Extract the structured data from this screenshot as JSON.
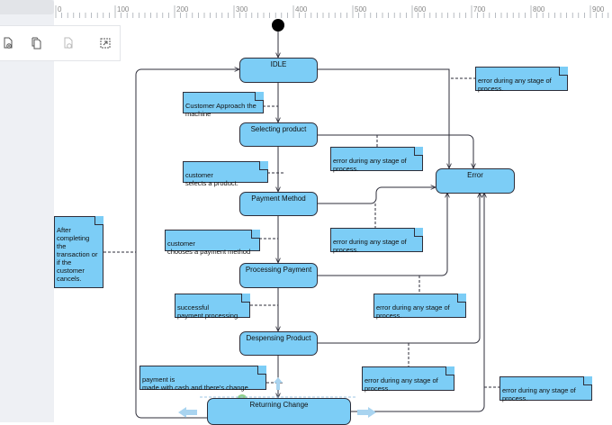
{
  "ruler": {
    "ticks": [
      "0",
      "100",
      "200",
      "300",
      "400",
      "500",
      "600",
      "700",
      "800",
      "900"
    ]
  },
  "toolbar": {
    "icons": [
      "add-page-icon",
      "duplicate-page-icon",
      "add-link-page-icon",
      "resize-page-icon"
    ]
  },
  "diagram": {
    "states": {
      "idle": "IDLE",
      "selecting_product": "Selecting product",
      "payment_method": "Payment Method",
      "processing_payment": "Processing  Payment",
      "despensing_product": "Despensing Product",
      "returning_change": "Returning Change",
      "error": "Error"
    },
    "notes": {
      "customer_approach": "Customer Approach  the\nmachine",
      "customer_selects": "customer\nselects a product.",
      "customer_chooses": "customer\nchooses a payment method",
      "successful_payment": "successful\npayment processing.",
      "payment_cash": "payment is\nmade with cash and there's change.",
      "after_completing": "After\ncompleting\nthe\ntransaction or\nif the\ncustomer\ncancels.",
      "error_1": "error during any stage of\nprocess.",
      "error_2": "error during any stage of\nprocess.",
      "error_3": "error during any stage of\nprocess.",
      "error_4": "error during any stage of\nprocess.",
      "error_5": "error during any stage of\nprocess.",
      "error_6": "error during any stage of\nprocess."
    }
  },
  "colors": {
    "state_fill": "#7ccdf6",
    "outline": "#2e2e3a",
    "selection_handle": "#8fd08a",
    "arrow_handle": "#a9d4f0"
  }
}
